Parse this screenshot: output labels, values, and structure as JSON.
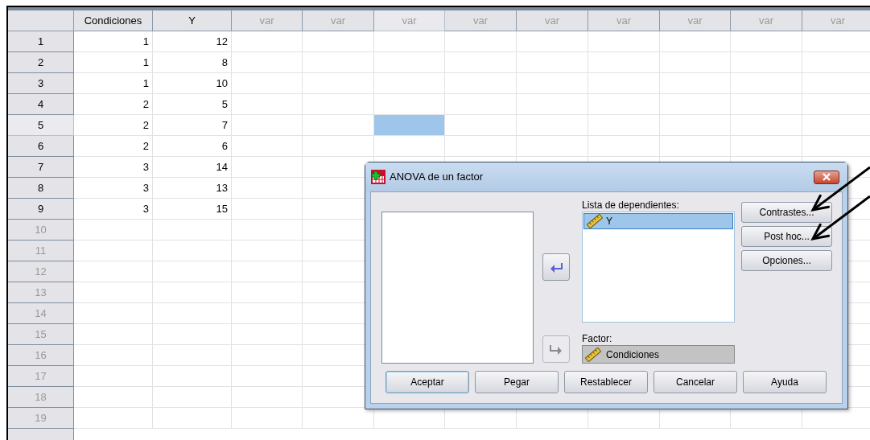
{
  "grid": {
    "columns": [
      {
        "label": "Condiciones",
        "kind": "variable",
        "selected": false
      },
      {
        "label": "Y",
        "kind": "variable",
        "selected": false
      },
      {
        "label": "var",
        "kind": "empty",
        "selected": false
      },
      {
        "label": "var",
        "kind": "empty",
        "selected": false
      },
      {
        "label": "var",
        "kind": "empty",
        "selected": true
      },
      {
        "label": "var",
        "kind": "empty",
        "selected": false
      },
      {
        "label": "var",
        "kind": "empty",
        "selected": false
      },
      {
        "label": "var",
        "kind": "empty",
        "selected": false
      },
      {
        "label": "var",
        "kind": "empty",
        "selected": false
      },
      {
        "label": "var",
        "kind": "empty",
        "selected": false
      },
      {
        "label": "var",
        "kind": "empty",
        "selected": false
      }
    ],
    "rows": [
      {
        "number": "1",
        "has_data": true,
        "selected": false,
        "cells": [
          "1",
          "12"
        ]
      },
      {
        "number": "2",
        "has_data": true,
        "selected": false,
        "cells": [
          "1",
          "8"
        ]
      },
      {
        "number": "3",
        "has_data": true,
        "selected": false,
        "cells": [
          "1",
          "10"
        ]
      },
      {
        "number": "4",
        "has_data": true,
        "selected": false,
        "cells": [
          "2",
          "5"
        ]
      },
      {
        "number": "5",
        "has_data": true,
        "selected": true,
        "cells": [
          "2",
          "7"
        ]
      },
      {
        "number": "6",
        "has_data": true,
        "selected": false,
        "cells": [
          "2",
          "6"
        ]
      },
      {
        "number": "7",
        "has_data": true,
        "selected": false,
        "cells": [
          "3",
          "14"
        ]
      },
      {
        "number": "8",
        "has_data": true,
        "selected": false,
        "cells": [
          "3",
          "13"
        ]
      },
      {
        "number": "9",
        "has_data": true,
        "selected": false,
        "cells": [
          "3",
          "15"
        ]
      },
      {
        "number": "10",
        "has_data": false,
        "selected": false
      },
      {
        "number": "11",
        "has_data": false,
        "selected": false
      },
      {
        "number": "12",
        "has_data": false,
        "selected": false
      },
      {
        "number": "13",
        "has_data": false,
        "selected": false
      },
      {
        "number": "14",
        "has_data": false,
        "selected": false
      },
      {
        "number": "15",
        "has_data": false,
        "selected": false
      },
      {
        "number": "16",
        "has_data": false,
        "selected": false
      },
      {
        "number": "17",
        "has_data": false,
        "selected": false
      },
      {
        "number": "18",
        "has_data": false,
        "selected": false
      },
      {
        "number": "19",
        "has_data": false,
        "selected": false
      }
    ]
  },
  "dialog": {
    "title": "ANOVA de un factor",
    "move_buttons": [
      {
        "kind": "left",
        "disabled": false
      },
      {
        "kind": "right",
        "disabled": true
      }
    ],
    "dependents": {
      "label": "Lista de dependientes:",
      "items": [
        {
          "label": "Y",
          "selected": true
        }
      ]
    },
    "factor": {
      "label": "Factor:",
      "value": "Condiciones"
    },
    "side_buttons": [
      {
        "label": "Contrastes...",
        "annotated": true
      },
      {
        "label": "Post hoc...",
        "annotated": true
      },
      {
        "label": "Opciones...",
        "annotated": false
      }
    ],
    "bottom_buttons": [
      {
        "label": "Aceptar",
        "default": true
      },
      {
        "label": "Pegar",
        "default": false
      },
      {
        "label": "Restablecer",
        "default": false
      },
      {
        "label": "Cancelar",
        "default": false
      },
      {
        "label": "Ayuda",
        "default": false
      }
    ]
  }
}
